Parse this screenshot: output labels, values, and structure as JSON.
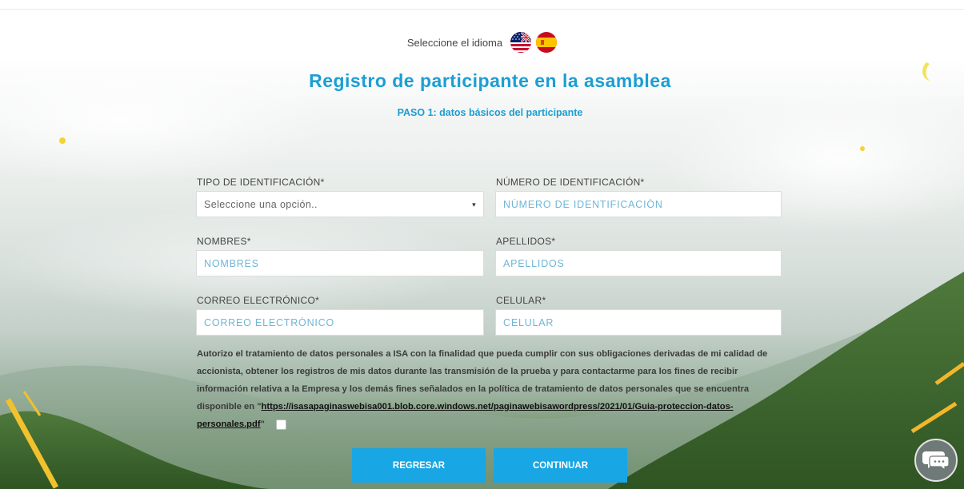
{
  "language": {
    "label": "Seleccione el idioma",
    "options": [
      {
        "name": "english",
        "icon": "us-uk-flag-icon"
      },
      {
        "name": "spanish",
        "icon": "spain-flag-icon"
      }
    ]
  },
  "header": {
    "title": "Registro de participante en la asamblea",
    "step": "PASO 1: datos básicos del participante"
  },
  "form": {
    "id_type": {
      "label": "TIPO DE IDENTIFICACIÓN*",
      "selected": "Seleccione una opción.."
    },
    "id_number": {
      "label": "NÚMERO DE IDENTIFICACIÓN*",
      "placeholder": "NÚMERO DE IDENTIFICACIÓN"
    },
    "first_names": {
      "label": "NOMBRES*",
      "placeholder": "NOMBRES"
    },
    "last_names": {
      "label": "APELLIDOS*",
      "placeholder": "APELLIDOS"
    },
    "email": {
      "label": "CORREO ELECTRÓNICO*",
      "placeholder": "CORREO ELECTRÓNICO"
    },
    "phone": {
      "label": "CELULAR*",
      "placeholder": "CELULAR"
    }
  },
  "consent": {
    "text": "Autorizo el tratamiento de datos personales a ISA con la finalidad que pueda cumplir con sus obligaciones derivadas de mi calidad de accionista, obtener los registros de mis datos durante las transmisión de la prueba y para contactarme para los fines de recibir información relativa a la Empresa y los demás fines señalados en la política de tratamiento de datos personales que se encuentra disponible en ",
    "link_text": "https://isasapaginaswebisa001.blob.core.windows.net/paginawebisawordpress/2021/01/Guia-proteccion-datos-personales.pdf",
    "checked": false
  },
  "buttons": {
    "back": "REGRESAR",
    "continue": "CONTINUAR"
  },
  "chat": {
    "icon": "chat-icon"
  },
  "colors": {
    "accent": "#1b9ed3",
    "button": "#18a6e4"
  }
}
